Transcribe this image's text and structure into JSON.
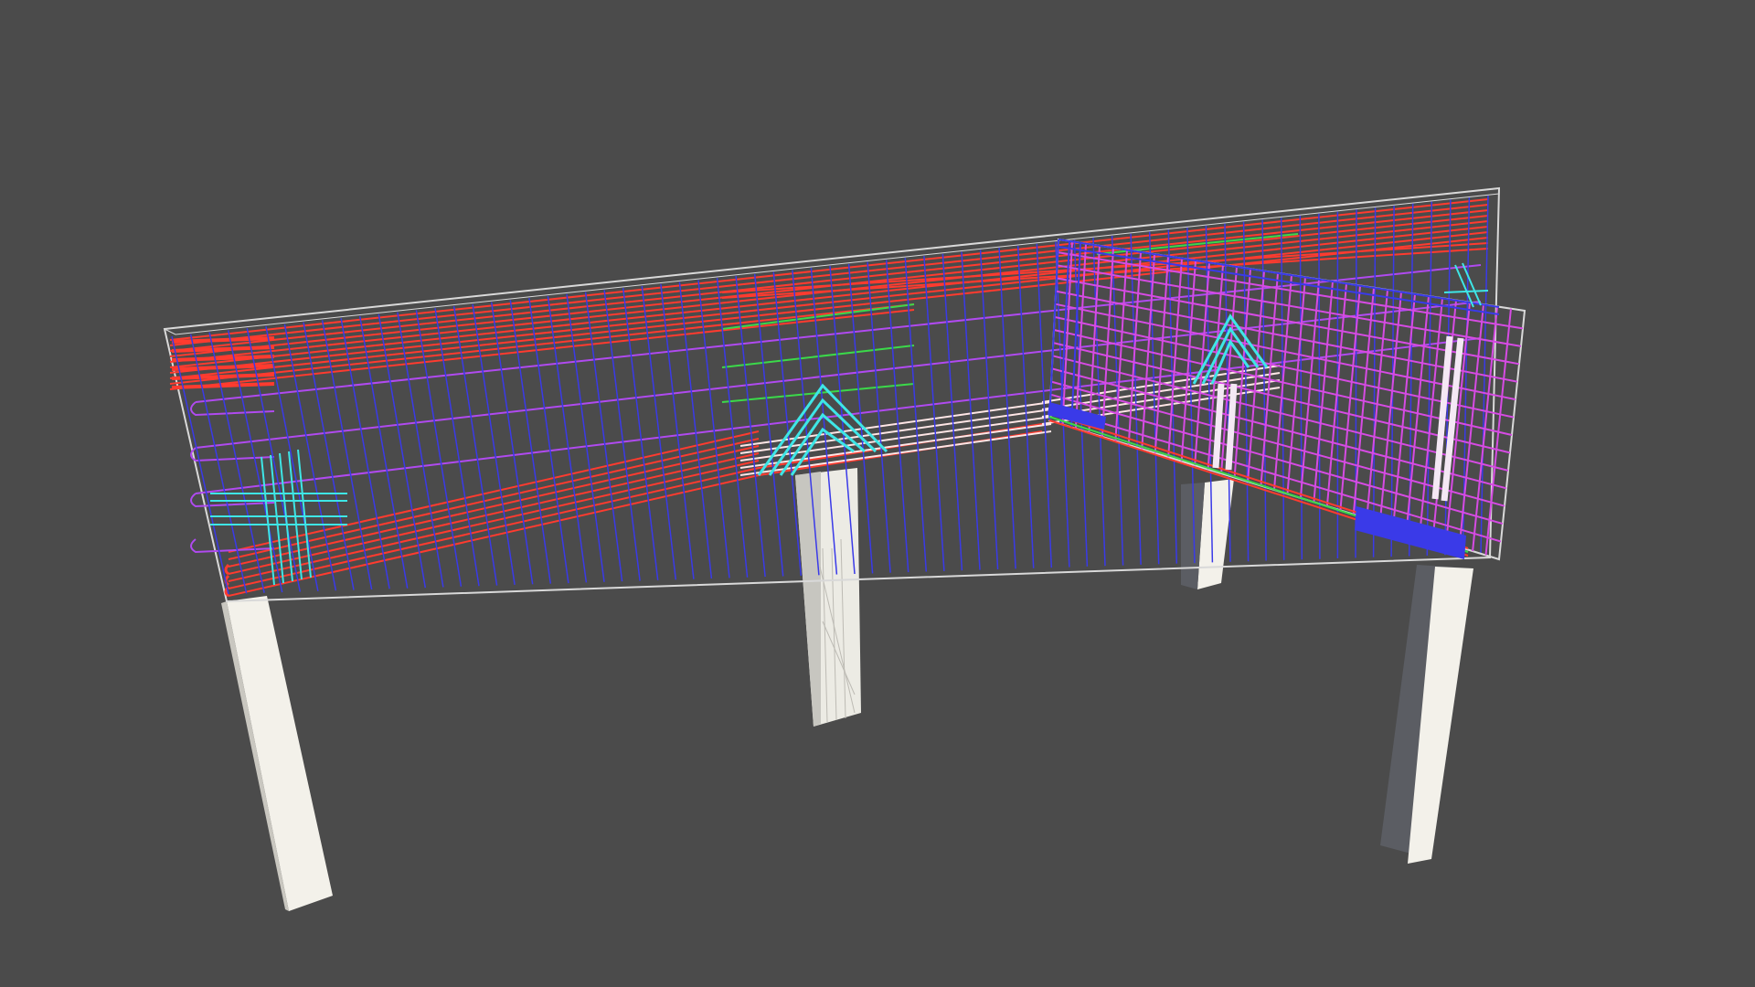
{
  "viewer": {
    "background": "#4b4b4b",
    "column_color": "#f3f1ea",
    "column_shade": "#5b5d63",
    "outline_color": "#d9d9d9"
  },
  "rebar_colors": {
    "longitudinal_main": "#ff3b2f",
    "stirrups": "#3333e6",
    "side_bars": "#b04af0",
    "additional_top": "#3bd94a",
    "hanger_bars": "#3ee6e6",
    "crossing_panel": "#d64be3"
  }
}
